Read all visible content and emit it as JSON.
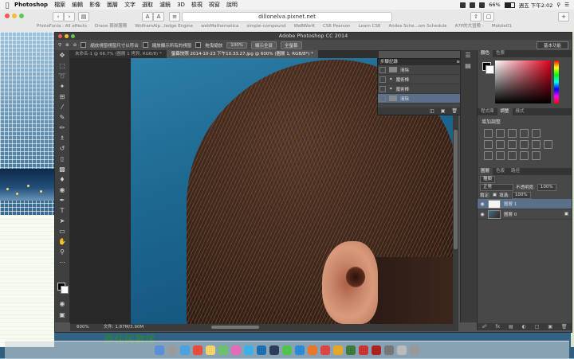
{
  "menubar": {
    "app": "Photoshop",
    "items": [
      "檔案",
      "編輯",
      "影像",
      "圖層",
      "文字",
      "選取",
      "濾鏡",
      "3D",
      "檢視",
      "視窗",
      "說明"
    ],
    "battery": "66%",
    "clock": "週五 下午2:02"
  },
  "browser": {
    "url": "dillonelva.pixnet.net",
    "bookmarks": [
      "PhotoFunia : All effects",
      "Drave 兩岸服務",
      "WolframAlp...ledge Engine",
      "webMathematica",
      "simple-compound",
      "WeBWorK",
      "CS6 Pearson",
      "Learn CS6",
      "Andes Sche...om Schedule",
      "A7P的大冒險 -",
      "Mobile01"
    ]
  },
  "ps": {
    "title": "Adobe Photoshop CC 2014",
    "options": {
      "resize_windows": "縮放視窗視窗尺寸以符合",
      "zoom_all": "縮放顯示所有的視窗",
      "scrubby_zoom": "拖曳縮放",
      "zoom_value": "100%",
      "fit_screen": "顯示全頁",
      "fill_screen": "全螢幕",
      "workspace": "基本功能"
    },
    "tabs": [
      "未命名-1 @ 66.7% (圖層 1 拷貝, RGB/8) *",
      "螢幕快照 2014-10-23 下午10.33.27.jpg @ 600% (圖層 1, RGB/8*) *"
    ],
    "status": {
      "zoom": "600%",
      "doc": "文件: 1.87M/3.90M"
    },
    "history": {
      "title": "步驟記錄",
      "steps": [
        "清除",
        "魔術棒",
        "魔術棒",
        "清除"
      ]
    },
    "color_tabs": [
      "顏色",
      "色票"
    ],
    "adjust_tabs": [
      "程式庫",
      "調整",
      "樣式"
    ],
    "adjust_title": "增加調整",
    "layer_tabs": [
      "圖層",
      "色版",
      "路徑"
    ],
    "layer_filter": "種類",
    "blend_mode": "正常",
    "opacity_label": "不透明度:",
    "opacity_value": "100%",
    "lock_label": "鎖定:",
    "fill_label": "填滿:",
    "fill_value": "100%",
    "layers": [
      "圖層 1",
      "圖層 0"
    ]
  },
  "web": {
    "decor": "原住民歌謠"
  }
}
